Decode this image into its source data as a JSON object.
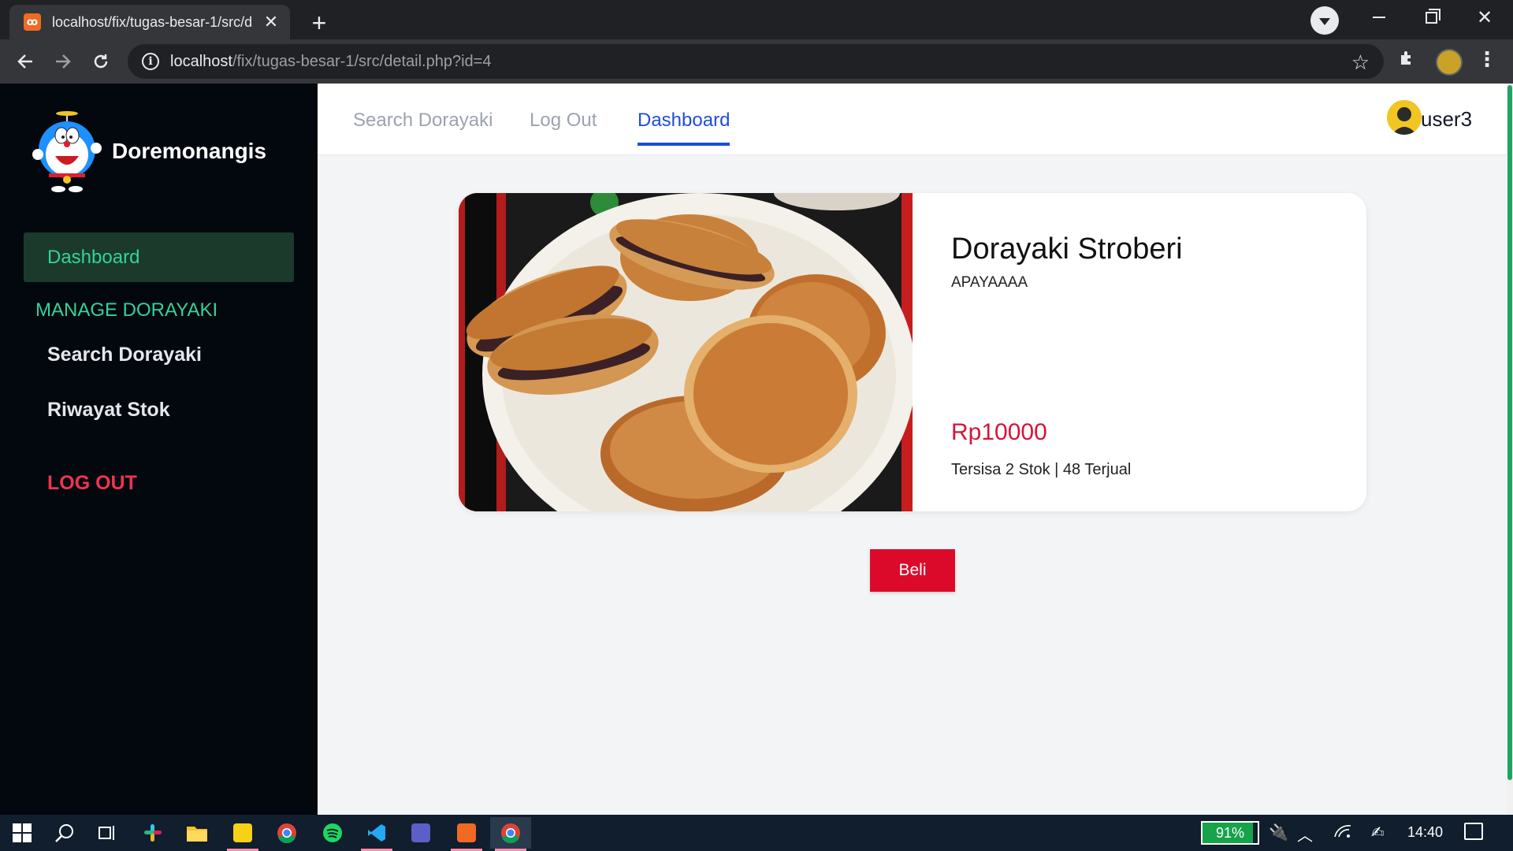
{
  "browser": {
    "tab_title": "localhost/fix/tugas-besar-1/src/d",
    "url_host": "localhost",
    "url_path": "/fix/tugas-besar-1/src/detail.php?id=4"
  },
  "sidebar": {
    "brand": "Doremonangis",
    "active_item": "Dashboard",
    "section_heading": "MANAGE DORAYAKI",
    "items": [
      {
        "label": "Search Dorayaki"
      },
      {
        "label": "Riwayat Stok"
      }
    ],
    "logout": "LOG OUT"
  },
  "topnav": {
    "links": [
      {
        "label": "Search Dorayaki"
      },
      {
        "label": "Log Out"
      },
      {
        "label": "Dashboard"
      }
    ],
    "active_index": 2,
    "username": "user3"
  },
  "product": {
    "name": "Dorayaki Stroberi",
    "description": "APAYAAAA",
    "price": "Rp10000",
    "stock_text": "Tersisa 2 Stok | 48 Terjual",
    "stock_remaining": 2,
    "sold": 48
  },
  "actions": {
    "buy_label": "Beli"
  },
  "taskbar": {
    "battery": "91%",
    "battery_level": 0.91,
    "time": "14:40"
  },
  "colors": {
    "accent_green": "#34d399",
    "active_blue": "#1d4ed8",
    "price_red": "#d6143a",
    "buy_red": "#dc0a2a",
    "logout_red": "#f0334f",
    "sidebar_bg": "#03080f"
  }
}
